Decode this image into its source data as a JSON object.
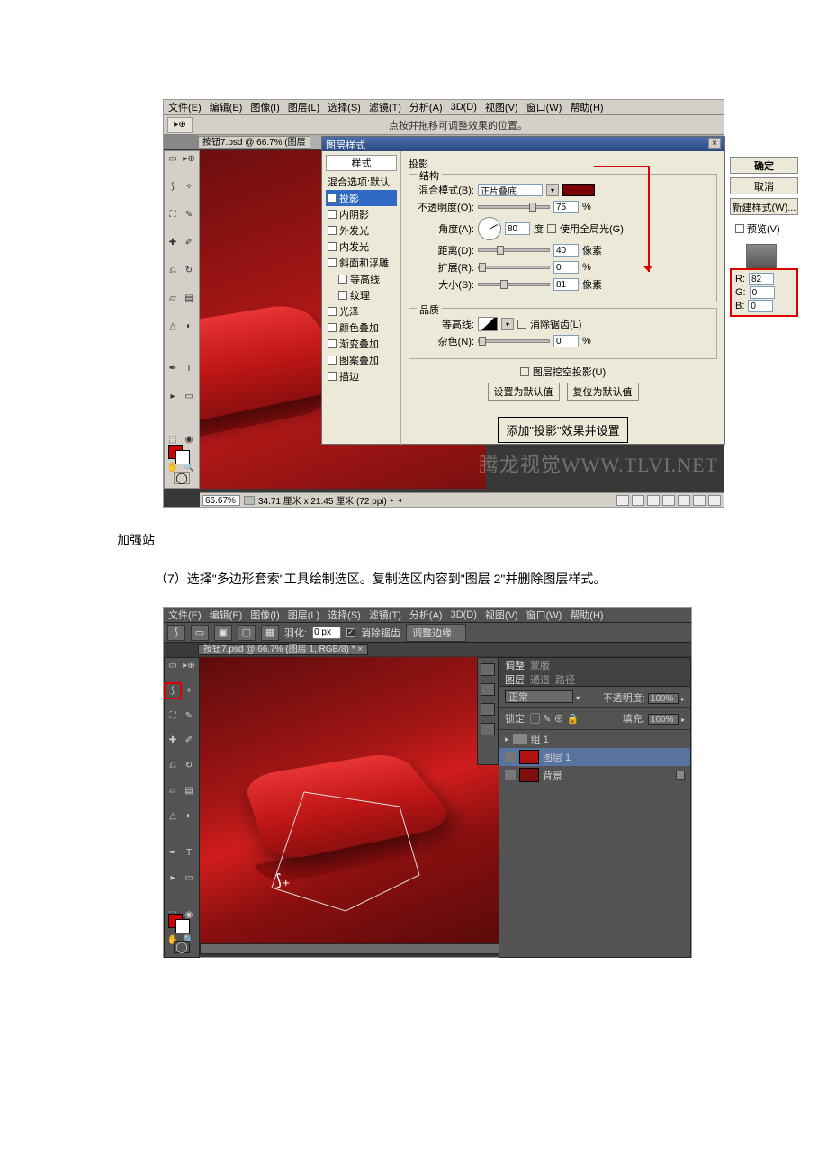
{
  "menu": {
    "file": "文件(E)",
    "edit": "编辑(E)",
    "image": "图像(I)",
    "layer": "图层(L)",
    "select": "选择(S)",
    "filter": "滤镜(T)",
    "analysis": "分析(A)",
    "threed": "3D(D)",
    "view": "视图(V)",
    "window": "窗口(W)",
    "help": "帮助(H)"
  },
  "toolbar1": {
    "hint": "点按并拖移可调整效果的位置。"
  },
  "doctab1": "按钮7.psd @ 66.7% (图层",
  "dialog": {
    "title": "图层样式",
    "styles_header": "样式",
    "styles": {
      "blend_default": "混合选项:默认",
      "drop_shadow": "投影",
      "inner_shadow": "内阴影",
      "outer_glow": "外发光",
      "inner_glow": "内发光",
      "bevel": "斜面和浮雕",
      "contour_sub": "等高线",
      "texture_sub": "纹理",
      "satin": "光泽",
      "color_overlay": "颜色叠加",
      "gradient_overlay": "渐变叠加",
      "pattern_overlay": "图案叠加",
      "stroke": "描边"
    },
    "panel": {
      "heading": "投影",
      "structure": "结构",
      "blend_mode_label": "混合模式(B):",
      "blend_mode_value": "正片叠底",
      "opacity_label": "不透明度(O):",
      "opacity_value": "75",
      "percent": "%",
      "angle_label": "角度(A):",
      "angle_value": "80",
      "degree": "度",
      "global_light": "使用全局光(G)",
      "distance_label": "距离(D):",
      "distance_value": "40",
      "px": "像素",
      "spread_label": "扩展(R):",
      "spread_value": "0",
      "size_label": "大小(S):",
      "size_value": "81",
      "quality": "品质",
      "contour_label": "等高线:",
      "antialias": "消除锯齿(L)",
      "noise_label": "杂色(N):",
      "noise_value": "0",
      "knockout": "图层挖空投影(U)",
      "set_default": "设置为默认值",
      "reset_default": "复位为默认值"
    },
    "buttons": {
      "ok": "确定",
      "cancel": "取消",
      "new_style": "新建样式(W)...",
      "preview": "预览(V)"
    },
    "rgb": {
      "r_label": "R:",
      "r": "82",
      "g_label": "G:",
      "g": "0",
      "b_label": "B:",
      "b": "0"
    },
    "callout": "添加\"投影\"效果并设置"
  },
  "watermark": "腾龙视觉WWW.TLVI.NET",
  "status1": {
    "zoom": "66.67%",
    "dims": "34.71 厘米 x 21.45 厘米 (72 ppi)"
  },
  "text1": "加强站",
  "text2": "（7）选择\"多边形套索\"工具绘制选区。复制选区内容到\"图层 2\"并删除图层样式。",
  "shot2": {
    "feather_label": "羽化:",
    "feather_value": "0 px",
    "antialias": "消除锯齿",
    "refine_edge": "调整边缘...",
    "doctab": "按钮7.psd @ 66.7% (图层 1, RGB/8) * ×",
    "panels": {
      "adjust_tab": "调整",
      "mask_tab": "蒙版",
      "layers_tab": "图层",
      "channels_tab": "通道",
      "paths_tab": "路径",
      "blend_normal": "正常",
      "opacity_label": "不透明度:",
      "opacity": "100%",
      "lock_label": "锁定:",
      "fill_label": "填充:",
      "fill": "100%",
      "group": "组 1",
      "layer1": "图层 1",
      "background": "背景"
    }
  }
}
